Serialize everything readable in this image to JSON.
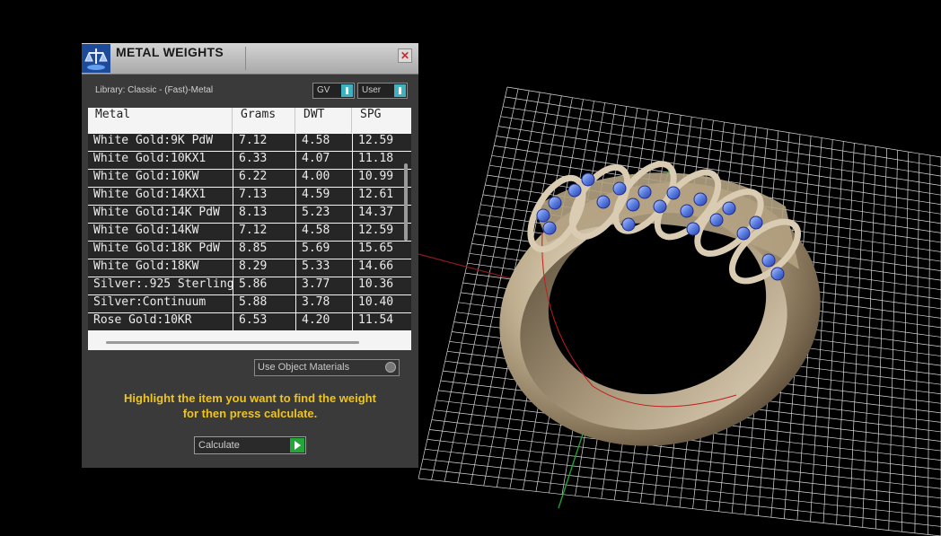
{
  "window": {
    "title": "METAL WEIGHTS"
  },
  "library": {
    "label": "Library: Classic - (Fast)-Metal"
  },
  "toggles": [
    {
      "label": "GV"
    },
    {
      "label": "User"
    }
  ],
  "table": {
    "columns": [
      "Metal",
      "Grams",
      "DWT",
      "SPG"
    ],
    "rows": [
      [
        "White Gold:9K PdW",
        "7.12",
        "4.58",
        "12.59"
      ],
      [
        "White Gold:10KX1",
        "6.33",
        "4.07",
        "11.18"
      ],
      [
        "White Gold:10KW",
        "6.22",
        "4.00",
        "10.99"
      ],
      [
        "White Gold:14KX1",
        "7.13",
        "4.59",
        "12.61"
      ],
      [
        "White Gold:14K PdW",
        "8.13",
        "5.23",
        "14.37"
      ],
      [
        "White Gold:14KW",
        "7.12",
        "4.58",
        "12.59"
      ],
      [
        "White Gold:18K PdW",
        "8.85",
        "5.69",
        "15.65"
      ],
      [
        "White Gold:18KW",
        "8.29",
        "5.33",
        "14.66"
      ],
      [
        "Silver:.925 Sterling",
        "5.86",
        "3.77",
        "10.36"
      ],
      [
        "Silver:Continuum",
        "5.88",
        "3.78",
        "10.40"
      ],
      [
        "Rose Gold:10KR",
        "6.53",
        "4.20",
        "11.54"
      ]
    ]
  },
  "use_object_materials": {
    "label": "Use Object Materials"
  },
  "hint": {
    "line1": "Highlight the item you want to find the weight",
    "line2": "for then press calculate."
  },
  "calculate": {
    "label": "Calculate"
  },
  "icons": {
    "title_icon": "scale-icon",
    "close": "close-icon",
    "calc": "play-icon"
  },
  "colors": {
    "accent": "#3fb2c2",
    "hint": "#f0c41a",
    "calc_green": "#22a83a",
    "gem": "#5a7de0",
    "ring_metal": "#b9a789"
  }
}
